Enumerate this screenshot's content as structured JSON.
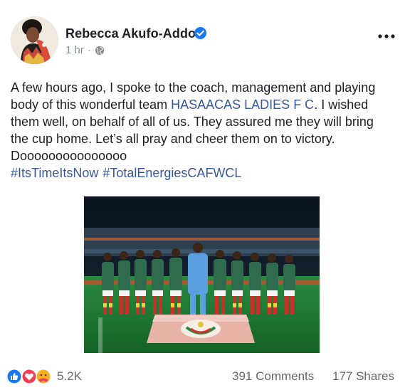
{
  "post": {
    "author": "Rebecca Akufo-Addo",
    "timestamp": "1 hr",
    "separator": "·",
    "privacy_icon": "globe-icon",
    "verified_icon": "verified-badge-icon",
    "more_icon": "more-options-icon",
    "text": {
      "line1": "A few hours ago, I spoke to the coach, management and playing",
      "line2_before": "body of this wonderful team ",
      "mention": "HASAACAS LADIES F C",
      "line2_after": ". I wished",
      "line3": "them well, on behalf of all of us. They assured me they will bring",
      "line4": "the cup home. Let’s all pray and cheer them on to victory.",
      "line5": "Dooooooooooooooo"
    },
    "hashtags": [
      "#ItsTimeItsNow",
      "#TotalEnergiesCAFWCL"
    ]
  },
  "engagement": {
    "reaction_icons": [
      "like-reaction-icon",
      "love-reaction-icon",
      "care-reaction-icon"
    ],
    "reaction_count": "5.2K",
    "comments": "391 Comments",
    "shares": "177 Shares"
  },
  "colors": {
    "link": "#385898",
    "meta": "#8a8d91",
    "text": "#1c1e21",
    "verified": "#1877f2",
    "like": "#1877f2",
    "love": "#f33e58",
    "care": "#f7b125",
    "pitch": "#1f7a34",
    "jersey": "#2f6b4d",
    "keeper_kit": "#5aa0df"
  }
}
